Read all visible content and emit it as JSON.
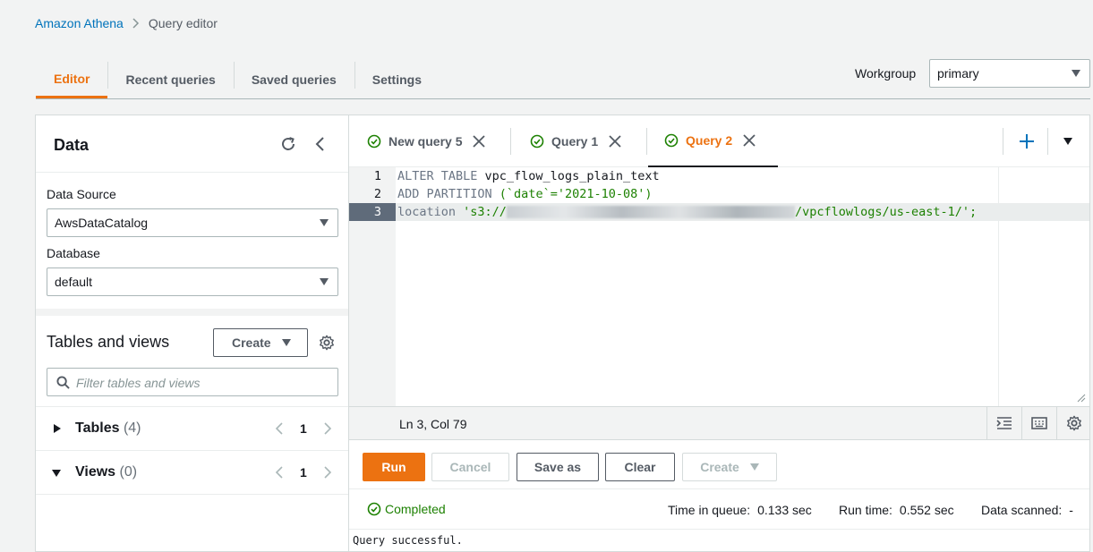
{
  "breadcrumb": {
    "root": "Amazon Athena",
    "current": "Query editor"
  },
  "top_tabs": [
    {
      "label": "Editor",
      "active": true
    },
    {
      "label": "Recent queries",
      "active": false
    },
    {
      "label": "Saved queries",
      "active": false
    },
    {
      "label": "Settings",
      "active": false
    }
  ],
  "workgroup": {
    "label": "Workgroup",
    "value": "primary"
  },
  "data_panel": {
    "title": "Data",
    "data_source_label": "Data Source",
    "data_source_value": "AwsDataCatalog",
    "database_label": "Database",
    "database_value": "default",
    "tables_views_title": "Tables and views",
    "create_label": "Create",
    "filter_placeholder": "Filter tables and views",
    "tables": {
      "label": "Tables",
      "count": "(4)",
      "page": "1"
    },
    "views": {
      "label": "Views",
      "count": "(0)",
      "page": "1"
    }
  },
  "query_tabs": [
    {
      "label": "New query 5",
      "active": false
    },
    {
      "label": "Query 1",
      "active": false
    },
    {
      "label": "Query 2",
      "active": true
    }
  ],
  "editor": {
    "lines": [
      {
        "num": "1",
        "kw": "ALTER TABLE",
        "rest": " vpc_flow_logs_plain_text"
      },
      {
        "num": "2",
        "kw": "ADD PARTITION",
        "rest": " (`date`='2021-10-08')"
      },
      {
        "num": "3",
        "kw": "location",
        "pre": " 's3://",
        "post": "/vpcflowlogs/us-east-1/';"
      }
    ],
    "cursor_position": "Ln 3, Col 79"
  },
  "actions": {
    "run": "Run",
    "cancel": "Cancel",
    "save_as": "Save as",
    "clear": "Clear",
    "create": "Create"
  },
  "result": {
    "status": "Completed",
    "time_in_queue_label": "Time in queue:",
    "time_in_queue_value": "0.133 sec",
    "run_time_label": "Run time:",
    "run_time_value": "0.552 sec",
    "data_scanned_label": "Data scanned:",
    "data_scanned_value": "-",
    "message": "Query successful."
  },
  "colors": {
    "accent": "#ec7211",
    "link": "#0073bb",
    "success": "#1d8102",
    "border": "#aab7b8"
  }
}
